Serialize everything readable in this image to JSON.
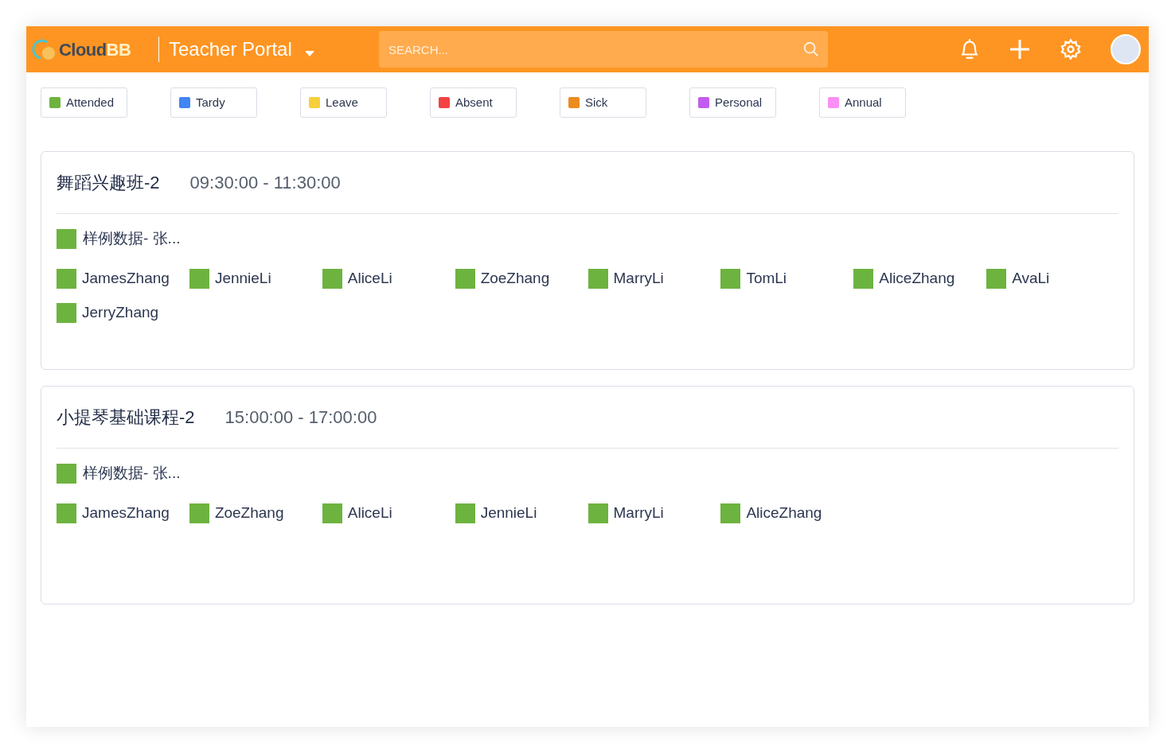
{
  "header": {
    "logo": {
      "part1": "Cloud",
      "part2": "BB"
    },
    "portal_title": "Teacher Portal",
    "search": {
      "placeholder": "SEARCH..."
    }
  },
  "legend": [
    {
      "label": "Attended",
      "color": "#6db33f"
    },
    {
      "label": "Tardy",
      "color": "#4285f4"
    },
    {
      "label": "Leave",
      "color": "#f7cf3b"
    },
    {
      "label": "Absent",
      "color": "#f44242"
    },
    {
      "label": "Sick",
      "color": "#ec8b1e"
    },
    {
      "label": "Personal",
      "color": "#c25cf0"
    },
    {
      "label": "Annual",
      "color": "#fb8ff5"
    }
  ],
  "classes": [
    {
      "name": "舞蹈兴趣班-2",
      "time": "09:30:00 - 11:30:00",
      "teacher": {
        "name": "样例数据- 张...",
        "color": "#6db33f"
      },
      "students": [
        {
          "name": "JamesZhang",
          "color": "#6db33f"
        },
        {
          "name": "JennieLi",
          "color": "#6db33f"
        },
        {
          "name": "AliceLi",
          "color": "#6db33f"
        },
        {
          "name": "ZoeZhang",
          "color": "#6db33f"
        },
        {
          "name": "MarryLi",
          "color": "#6db33f"
        },
        {
          "name": "TomLi",
          "color": "#6db33f"
        },
        {
          "name": "AliceZhang",
          "color": "#6db33f"
        },
        {
          "name": "AvaLi",
          "color": "#6db33f"
        },
        {
          "name": "JerryZhang",
          "color": "#6db33f"
        }
      ]
    },
    {
      "name": "小提琴基础课程-2",
      "time": "15:00:00 - 17:00:00",
      "teacher": {
        "name": "样例数据- 张...",
        "color": "#6db33f"
      },
      "students": [
        {
          "name": "JamesZhang",
          "color": "#6db33f"
        },
        {
          "name": "ZoeZhang",
          "color": "#6db33f"
        },
        {
          "name": "AliceLi",
          "color": "#6db33f"
        },
        {
          "name": "JennieLi",
          "color": "#6db33f"
        },
        {
          "name": "MarryLi",
          "color": "#6db33f"
        },
        {
          "name": "AliceZhang",
          "color": "#6db33f"
        }
      ]
    }
  ]
}
